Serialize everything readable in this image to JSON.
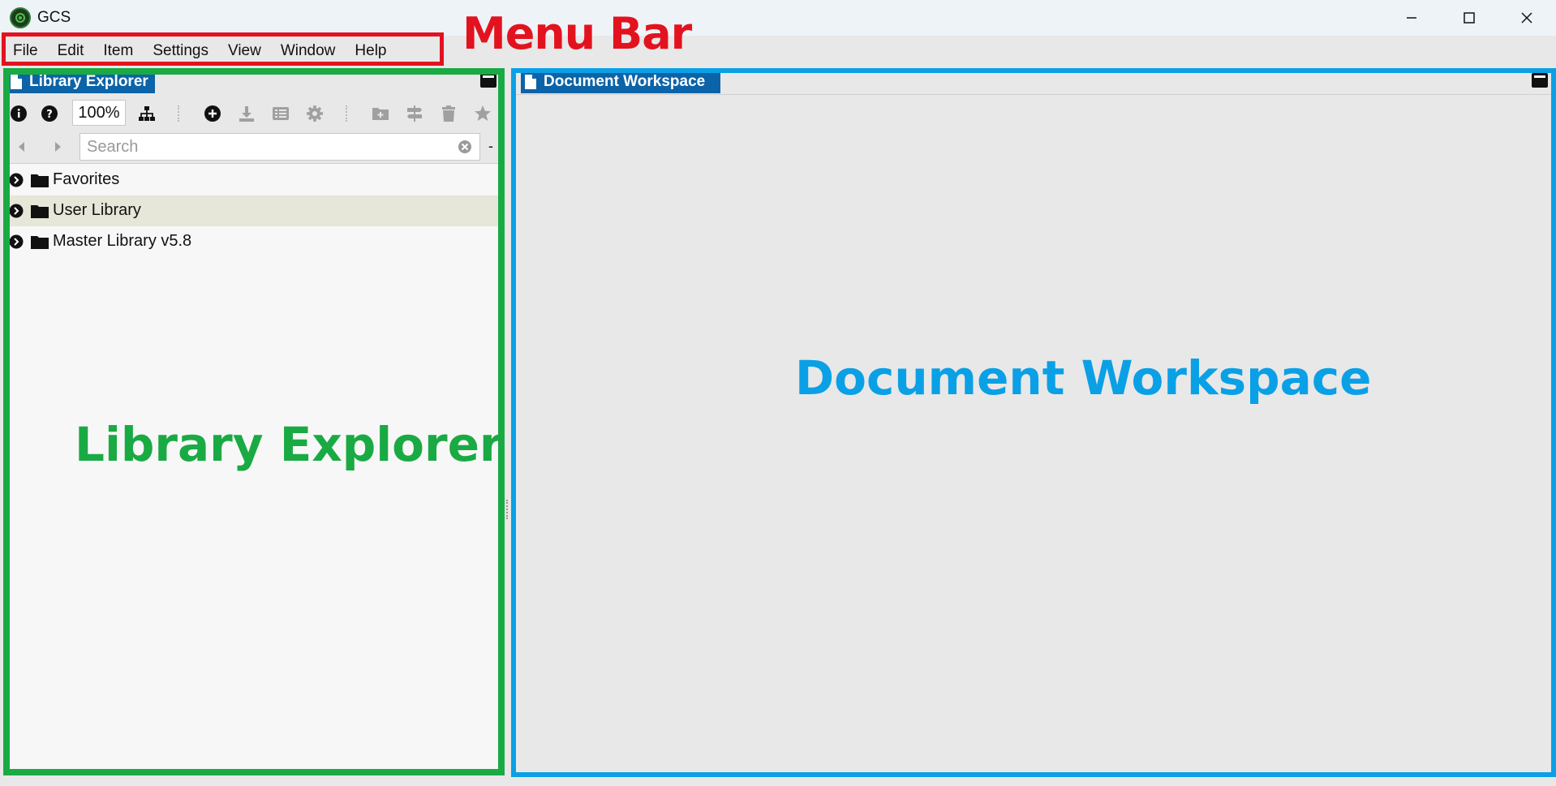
{
  "app": {
    "title": "GCS"
  },
  "window_controls": {
    "minimize": "minimize-icon",
    "maximize": "maximize-icon",
    "close": "close-icon"
  },
  "menubar": {
    "items": [
      {
        "label": "File"
      },
      {
        "label": "Edit"
      },
      {
        "label": "Item"
      },
      {
        "label": "Settings"
      },
      {
        "label": "View"
      },
      {
        "label": "Window"
      },
      {
        "label": "Help"
      }
    ]
  },
  "library": {
    "tab_label": "Library Explorer",
    "zoom": "100%",
    "search_placeholder": "Search",
    "search_extra": "-",
    "tree": [
      {
        "label": "Favorites",
        "selected": false
      },
      {
        "label": "User Library",
        "selected": true
      },
      {
        "label": "Master Library v5.8",
        "selected": false
      }
    ]
  },
  "document": {
    "tab_label": "Document Workspace"
  },
  "annotations": {
    "menu_bar": "Menu Bar",
    "library_explorer": "Library Explorer",
    "document_workspace": "Document Workspace"
  },
  "colors": {
    "accent_tab": "#0b63a8",
    "menu_callout": "#e3121f",
    "library_callout": "#1aaa44",
    "workspace_callout": "#0aa0e6",
    "selected_row": "#e6e6d9"
  }
}
